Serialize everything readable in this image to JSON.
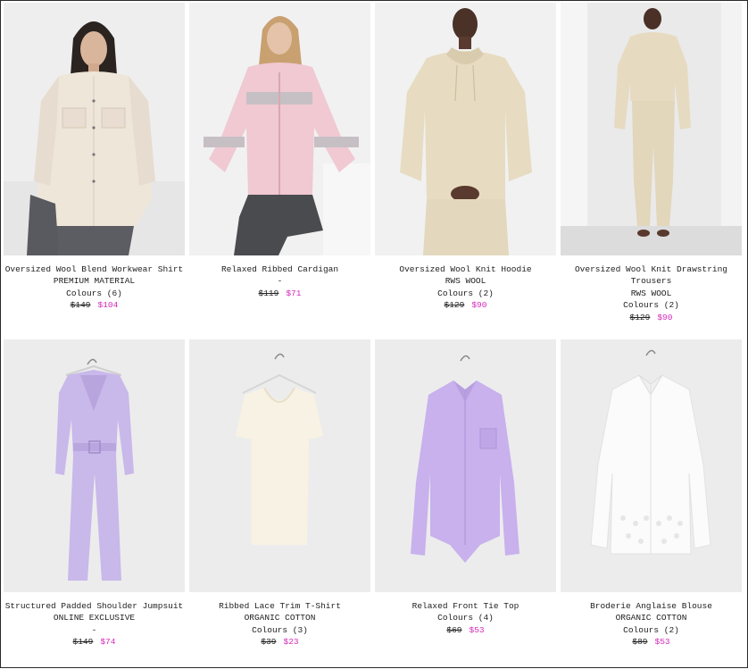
{
  "colors": {
    "sale": "#d42ab9",
    "text": "#222222",
    "background": "#ffffff"
  },
  "products": [
    {
      "name": "Oversized Wool Blend Workwear Shirt",
      "tag": "PREMIUM MATERIAL",
      "colours": "Colours (6)",
      "dash": "",
      "old_price": "$149",
      "new_price": "$104",
      "image": "woman-in-cream-overshirt"
    },
    {
      "name": "Relaxed Ribbed Cardigan",
      "tag": "",
      "colours": "",
      "dash": "-",
      "old_price": "$119",
      "new_price": "$71",
      "image": "woman-in-pink-cardigan"
    },
    {
      "name": "Oversized Wool Knit Hoodie",
      "tag": "RWS WOOL",
      "colours": "Colours (2)",
      "dash": "",
      "old_price": "$129",
      "new_price": "$90",
      "image": "woman-in-beige-hoodie"
    },
    {
      "name": "Oversized Wool Knit Drawstring Trousers",
      "tag": "RWS WOOL",
      "colours": "Colours (2)",
      "dash": "",
      "old_price": "$129",
      "new_price": "$90",
      "image": "woman-in-beige-knit-set"
    },
    {
      "name": "Structured Padded Shoulder Jumpsuit",
      "tag": "ONLINE EXCLUSIVE",
      "colours": "",
      "dash": "-",
      "old_price": "$149",
      "new_price": "$74",
      "image": "lilac-jumpsuit-on-hanger"
    },
    {
      "name": "Ribbed Lace Trim T-Shirt",
      "tag": "ORGANIC COTTON",
      "colours": "Colours (3)",
      "dash": "",
      "old_price": "$39",
      "new_price": "$23",
      "image": "cream-tshirt-on-hanger"
    },
    {
      "name": "Relaxed Front Tie Top",
      "tag": "",
      "colours": "Colours (4)",
      "dash": "",
      "old_price": "$69",
      "new_price": "$53",
      "image": "lilac-tie-top-on-hanger"
    },
    {
      "name": "Broderie Anglaise Blouse",
      "tag": "ORGANIC COTTON",
      "colours": "Colours (2)",
      "dash": "",
      "old_price": "$89",
      "new_price": "$53",
      "image": "white-blouse-on-hanger"
    }
  ]
}
